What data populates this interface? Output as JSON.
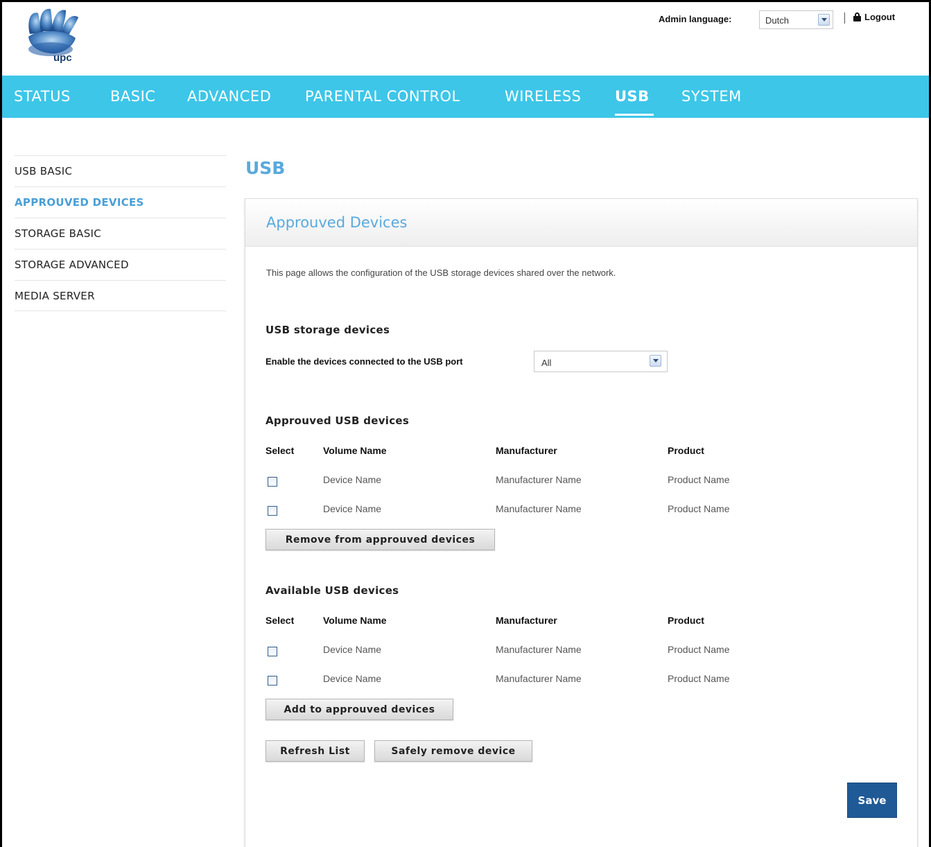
{
  "header": {
    "logo_text": "upc",
    "admin_language_label": "Admin language:",
    "language_value": "Dutch",
    "logout_label": "Logout"
  },
  "nav": {
    "items": [
      {
        "label": "STATUS"
      },
      {
        "label": "BASIC"
      },
      {
        "label": "ADVANCED"
      },
      {
        "label": "PARENTAL CONTROL"
      },
      {
        "label": "WIRELESS"
      },
      {
        "label": "USB",
        "active": true
      },
      {
        "label": "SYSTEM"
      }
    ]
  },
  "sidebar": {
    "items": [
      {
        "label": "USB BASIC"
      },
      {
        "label": "APPROUVED DEVICES",
        "active": true
      },
      {
        "label": "STORAGE BASIC"
      },
      {
        "label": "STORAGE ADVANCED"
      },
      {
        "label": "MEDIA SERVER"
      }
    ]
  },
  "main": {
    "page_title": "USB",
    "panel_title": "Approuved Devices",
    "description": "This page allows the configuration of the USB storage devices shared over the network.",
    "storage_section": {
      "title": "USB storage devices",
      "enable_label": "Enable the devices connected to the USB port",
      "enable_value": "All"
    },
    "approved_section": {
      "title": "Approuved USB devices",
      "headers": [
        "Select",
        "Volume Name",
        "Manufacturer",
        "Product"
      ],
      "rows": [
        {
          "volume": "Device Name",
          "manufacturer": "Manufacturer Name",
          "product": "Product Name"
        },
        {
          "volume": "Device Name",
          "manufacturer": "Manufacturer Name",
          "product": "Product Name"
        }
      ],
      "remove_button": "Remove from approuved devices"
    },
    "available_section": {
      "title": "Available USB devices",
      "headers": [
        "Select",
        "Volume Name",
        "Manufacturer",
        "Product"
      ],
      "rows": [
        {
          "volume": "Device Name",
          "manufacturer": "Manufacturer Name",
          "product": "Product Name"
        },
        {
          "volume": "Device Name",
          "manufacturer": "Manufacturer Name",
          "product": "Product Name"
        }
      ],
      "add_button": "Add to approuved devices"
    },
    "refresh_button": "Refresh List",
    "safely_remove_button": "Safely remove device",
    "save_button": "Save"
  },
  "colors": {
    "nav_bg": "#3dc6e8",
    "accent_blue": "#5aa9dc",
    "save_bg": "#1f5a96"
  },
  "icons": [
    "upc-logo",
    "lock-icon",
    "dropdown-arrow-icon"
  ]
}
